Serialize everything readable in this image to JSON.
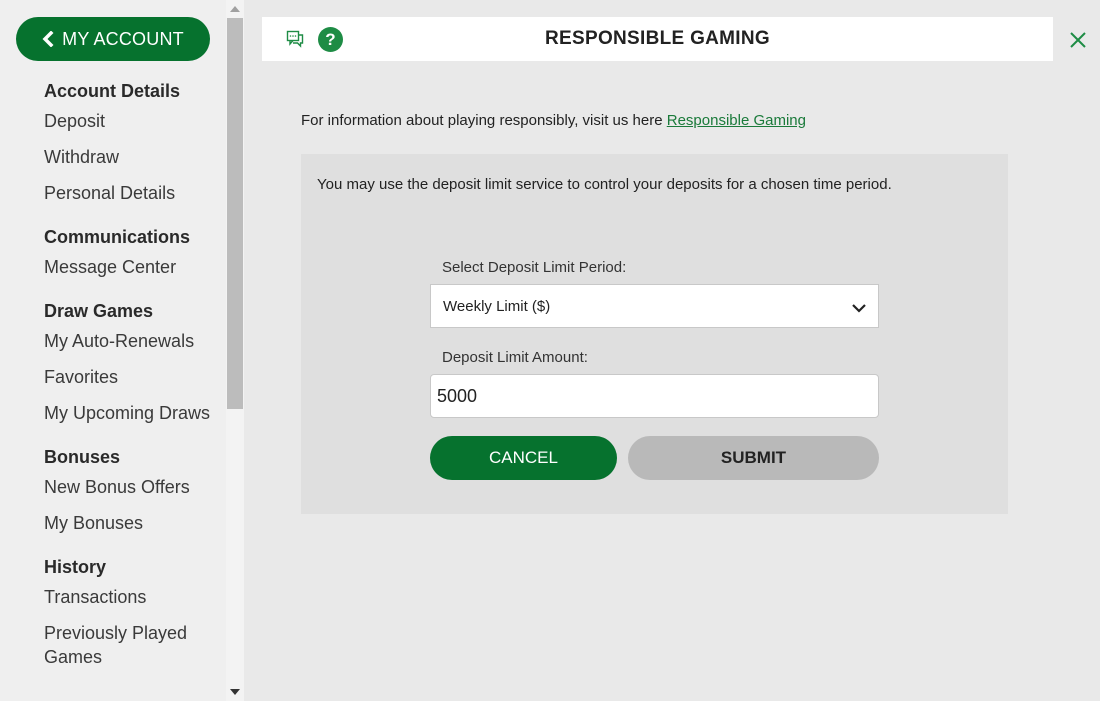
{
  "sidebar": {
    "my_account_label": "MY ACCOUNT",
    "groups": [
      {
        "heading": "Account Details",
        "items": [
          "Deposit",
          "Withdraw",
          "Personal Details"
        ]
      },
      {
        "heading": "Communications",
        "items": [
          "Message Center"
        ]
      },
      {
        "heading": "Draw Games",
        "items": [
          "My Auto-Renewals",
          "Favorites",
          "My Upcoming Draws"
        ]
      },
      {
        "heading": "Bonuses",
        "items": [
          "New Bonus Offers",
          "My Bonuses"
        ]
      },
      {
        "heading": "History",
        "items": [
          "Transactions",
          "Previously Played Games"
        ]
      }
    ]
  },
  "header": {
    "title": "RESPONSIBLE GAMING",
    "icons": [
      "chat-icon",
      "help-icon",
      "close-icon"
    ]
  },
  "main": {
    "info_text": "For information about playing responsibly, visit us here ",
    "info_link": "Responsible Gaming",
    "panel_text": "You may use the deposit limit service to control your deposits for a chosen time period.",
    "period_label": "Select Deposit Limit Period:",
    "period_value": "Weekly Limit ($)",
    "amount_label": "Deposit Limit Amount:",
    "amount_value": "5000",
    "cancel_label": "CANCEL",
    "submit_label": "SUBMIT"
  },
  "colors": {
    "brand_green": "#06722e",
    "link_green": "#1a7a3a",
    "submit_gray": "#b9b9b9"
  }
}
